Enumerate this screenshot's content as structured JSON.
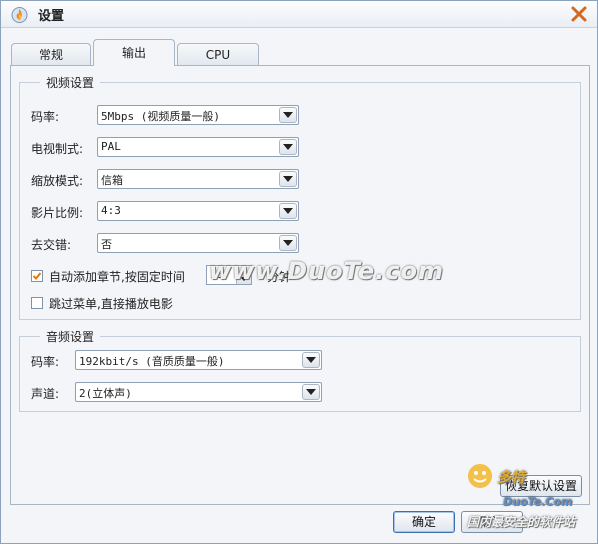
{
  "window": {
    "title": "设置",
    "icon": "fire-app-icon",
    "close": "close-icon"
  },
  "tabs": [
    {
      "label": "常规",
      "active": false
    },
    {
      "label": "输出",
      "active": true
    },
    {
      "label": "CPU",
      "active": false
    }
  ],
  "video": {
    "group_title": "视频设置",
    "bitrate": {
      "label": "码率:",
      "value": "5Mbps (视频质量一般)"
    },
    "tv_system": {
      "label": "电视制式:",
      "value": "PAL"
    },
    "zoom_mode": {
      "label": "缩放模式:",
      "value": "信箱"
    },
    "aspect_ratio": {
      "label": "影片比例:",
      "value": "4:3"
    },
    "deinterlace": {
      "label": "去交错:",
      "value": "否"
    },
    "auto_chapter": {
      "label": "自动添加章节,按固定时间",
      "checked": true,
      "interval": "15",
      "unit": "分钟"
    },
    "skip_menu": {
      "label": "跳过菜单,直接播放电影",
      "checked": false
    }
  },
  "audio": {
    "group_title": "音频设置",
    "bitrate": {
      "label": "码率:",
      "value": "192kbit/s (音质质量一般)"
    },
    "channel": {
      "label": "声道:",
      "value": "2(立体声)"
    }
  },
  "buttons": {
    "restore": "恢复默认设置",
    "ok": "确定",
    "cancel": "取消"
  },
  "watermarks": {
    "main": "www.DuoTe.com",
    "corner_brand": "多特",
    "corner_url": "DuoTe.Com",
    "corner_slogan": "国内最安全的软件站"
  },
  "colors": {
    "accent": "#e87a1a",
    "border": "#a9b6c6",
    "background": "#f3f5f8"
  }
}
